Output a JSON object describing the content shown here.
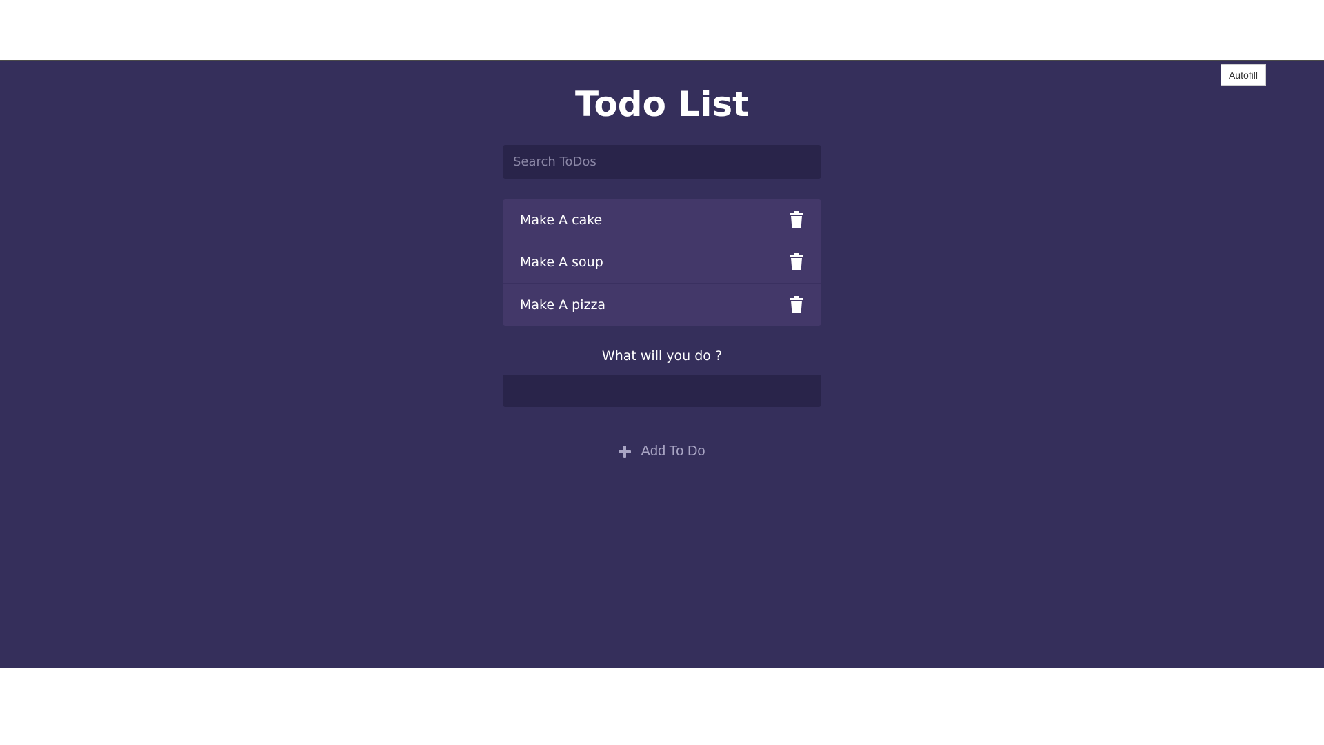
{
  "autofill": {
    "label": "Autofill"
  },
  "header": {
    "title": "Todo List"
  },
  "search": {
    "placeholder": "Search ToDos",
    "value": ""
  },
  "todos": [
    {
      "label": "Make A cake"
    },
    {
      "label": "Make A soup"
    },
    {
      "label": "Make A pizza"
    }
  ],
  "add_form": {
    "label": "What will you do ?",
    "input_value": "",
    "button_label": "Add To Do"
  },
  "icons": {
    "delete": "trash-icon",
    "add": "plus-icon"
  },
  "colors": {
    "background": "#352f5b",
    "input_bg": "#29244a",
    "item_bg": "#433869",
    "text": "#ffffff",
    "muted_text": "#a9a5c4"
  }
}
